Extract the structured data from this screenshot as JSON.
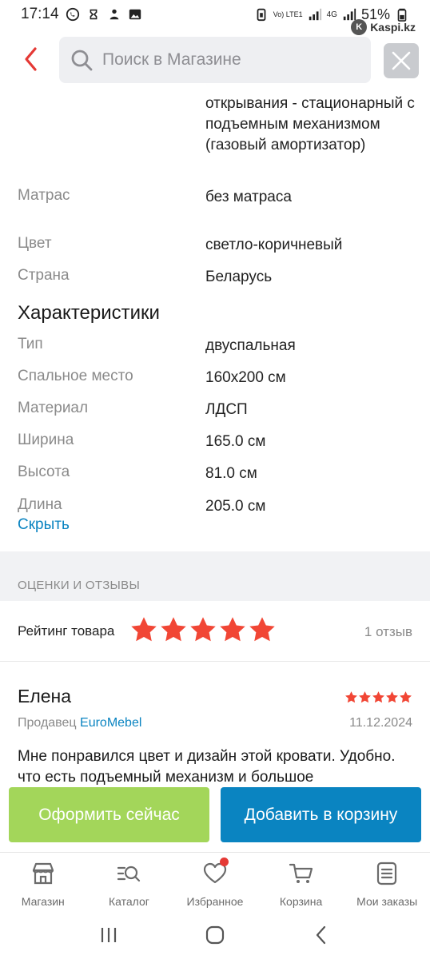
{
  "status_bar": {
    "time": "17:14",
    "battery": "51%",
    "network": "4G",
    "volte": "Vo) LTE1"
  },
  "app_badge": {
    "label": "Kaspi.kz"
  },
  "header": {
    "search_placeholder": "Поиск в Магазине"
  },
  "specs_top": [
    {
      "label": "",
      "value": "открывания - стационарный с подъемным механизмом (газовый амортизатор)"
    },
    {
      "label": "Матрас",
      "value": "без матраса"
    },
    {
      "label": "Цвет",
      "value": "светло-коричневый"
    },
    {
      "label": "Страна",
      "value": "Беларусь"
    }
  ],
  "characteristics": {
    "title": "Характеристики",
    "items": [
      {
        "label": "Тип",
        "value": "двуспальная"
      },
      {
        "label": "Спальное место",
        "value": "160x200 см"
      },
      {
        "label": "Материал",
        "value": "ЛДСП"
      },
      {
        "label": "Ширина",
        "value": "165.0 см"
      },
      {
        "label": "Высота",
        "value": "81.0 см"
      },
      {
        "label": "Длина",
        "value": "205.0 см"
      }
    ],
    "hide_link": "Скрыть"
  },
  "reviews": {
    "section_title": "ОЦЕНКИ И ОТЗЫВЫ",
    "rating_label": "Рейтинг товара",
    "rating_value": 5,
    "rating_count": "1 отзыв",
    "items": [
      {
        "author": "Елена",
        "stars": 5,
        "seller_prefix": "Продавец",
        "seller_name": "EuroMebel",
        "date": "11.12.2024",
        "text": "Мне понравился цвет и дизайн этой кровати. Удобно. что есть подъемный механизм и большое"
      }
    ]
  },
  "actions": {
    "order_now": "Оформить сейчас",
    "add_to_cart": "Добавить в корзину"
  },
  "bottom_nav": [
    {
      "label": "Магазин",
      "icon": "store-icon"
    },
    {
      "label": "Каталог",
      "icon": "catalog-search-icon"
    },
    {
      "label": "Избранное",
      "icon": "heart-icon",
      "has_badge": true
    },
    {
      "label": "Корзина",
      "icon": "cart-icon"
    },
    {
      "label": "Мои заказы",
      "icon": "orders-icon"
    }
  ],
  "colors": {
    "accent_blue": "#0a84c1",
    "accent_green": "#a3d65a",
    "star_red": "#f14635",
    "back_red": "#e53935"
  }
}
